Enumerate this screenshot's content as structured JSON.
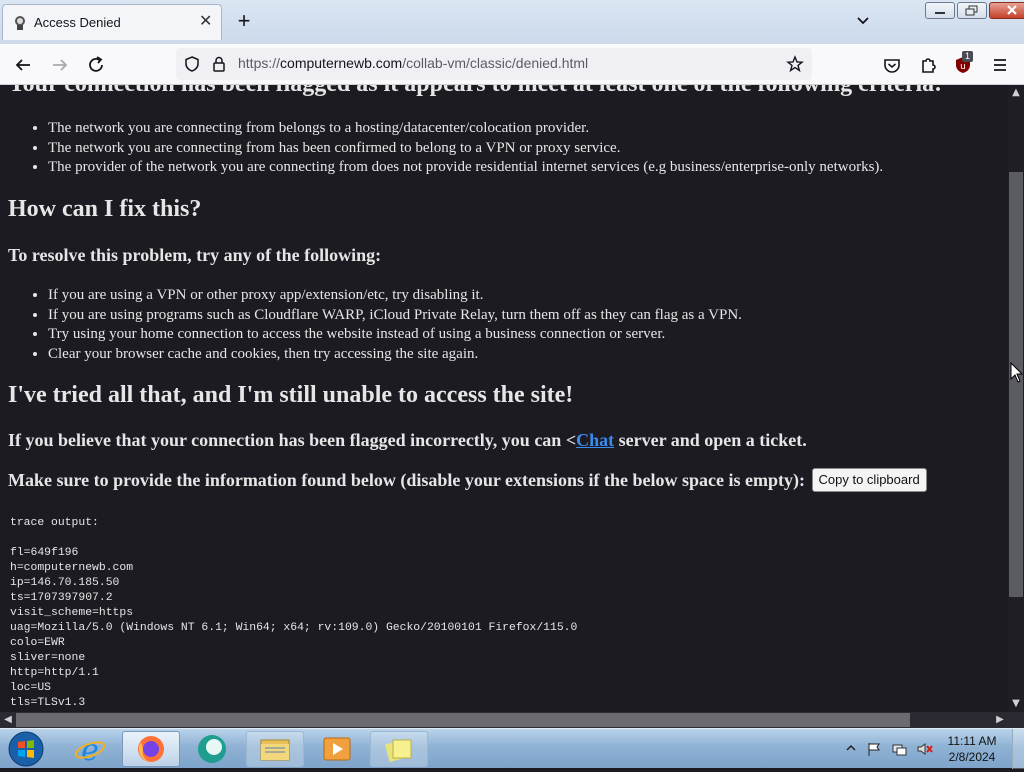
{
  "browser": {
    "tab_title": "Access Denied",
    "new_tab_symbol": "+",
    "url_prefix": "https://",
    "url_host": "computernewb.com",
    "url_path": "/collab-vm/classic/denied.html",
    "extension_badge": "1"
  },
  "page": {
    "cut_heading": "Your connection has been flagged as it appears to meet at least one of the following criteria:",
    "criteria": [
      "The network you are connecting from belongs to a hosting/datacenter/colocation provider.",
      "The network you are connecting from has been confirmed to belong to a VPN or proxy service.",
      "The provider of the network you are connecting from does not provide residential internet services (e.g business/enterprise-only networks)."
    ],
    "fix_heading": "How can I fix this?",
    "resolve_heading": "To resolve this problem, try any of the following:",
    "steps": [
      "If you are using a VPN or other proxy app/extension/etc, try disabling it.",
      "If you are using programs such as Cloudflare WARP, iCloud Private Relay, turn them off as they can flag as a VPN.",
      "Try using your home connection to access the website instead of using a business connection or server.",
      "Clear your browser cache and cookies, then try accessing the site again."
    ],
    "tried_heading": "I've tried all that, and I'm still unable to access the site!",
    "flagged_text_before": "If you believe that your connection has been flagged incorrectly, you can <",
    "flagged_link": "Chat",
    "flagged_text_after": " server and open a ticket.",
    "provide_text": "Make sure to provide the information found below (disable your extensions if the below space is empty):",
    "copy_button": "Copy to clipboard",
    "trace_output": "trace output:\n\nfl=649f196\nh=computernewb.com\nip=146.70.185.50\nts=1707397907.2\nvisit_scheme=https\nuag=Mozilla/5.0 (Windows NT 6.1; Win64; x64; rv:109.0) Gecko/20100101 Firefox/115.0\ncolo=EWR\nsliver=none\nhttp=http/1.1\nloc=US\ntls=TLSv1.3"
  },
  "taskbar": {
    "time": "11:11 AM",
    "date": "2/8/2024"
  },
  "colors": {
    "page_bg": "#1c1b22",
    "page_text": "#e6e6e6",
    "link": "#3a8cf0"
  }
}
